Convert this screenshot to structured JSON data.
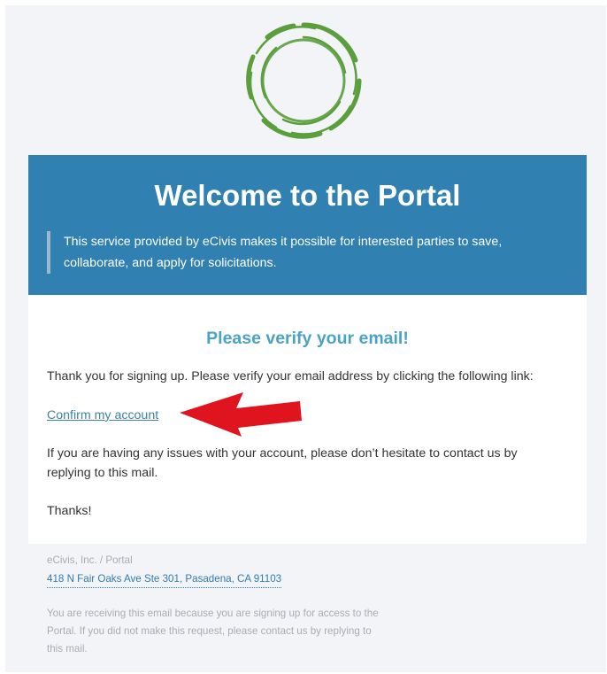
{
  "banner": {
    "title": "Welcome to the Portal",
    "quote": "This service provided by eCivis makes it possible for interested parties to save, collaborate, and apply for solicitations."
  },
  "card": {
    "heading": "Please verify your email!",
    "intro": "Thank you for signing up. Please verify your email address by clicking the following link:",
    "confirm_link": "Confirm my account",
    "issues": "If you are having any issues with your account, please don’t hesitate to contact us by replying to this mail.",
    "thanks": "Thanks!"
  },
  "footer": {
    "company": "eCivis, Inc. / Portal",
    "address": "418 N Fair Oaks Ave Ste 301, Pasadena, CA 91103",
    "notice": "You are receiving this email because you are signing up for access to the Portal. If you did not make this request, please contact us by replying to this mail."
  },
  "colors": {
    "banner": "#3080b2",
    "heading": "#4aa3c4",
    "logo_green": "#5a9f3c",
    "annotation_arrow": "#e0141e"
  },
  "icons": {
    "logo": "green-swirl-logo-icon",
    "annotation": "red-arrow-icon"
  }
}
